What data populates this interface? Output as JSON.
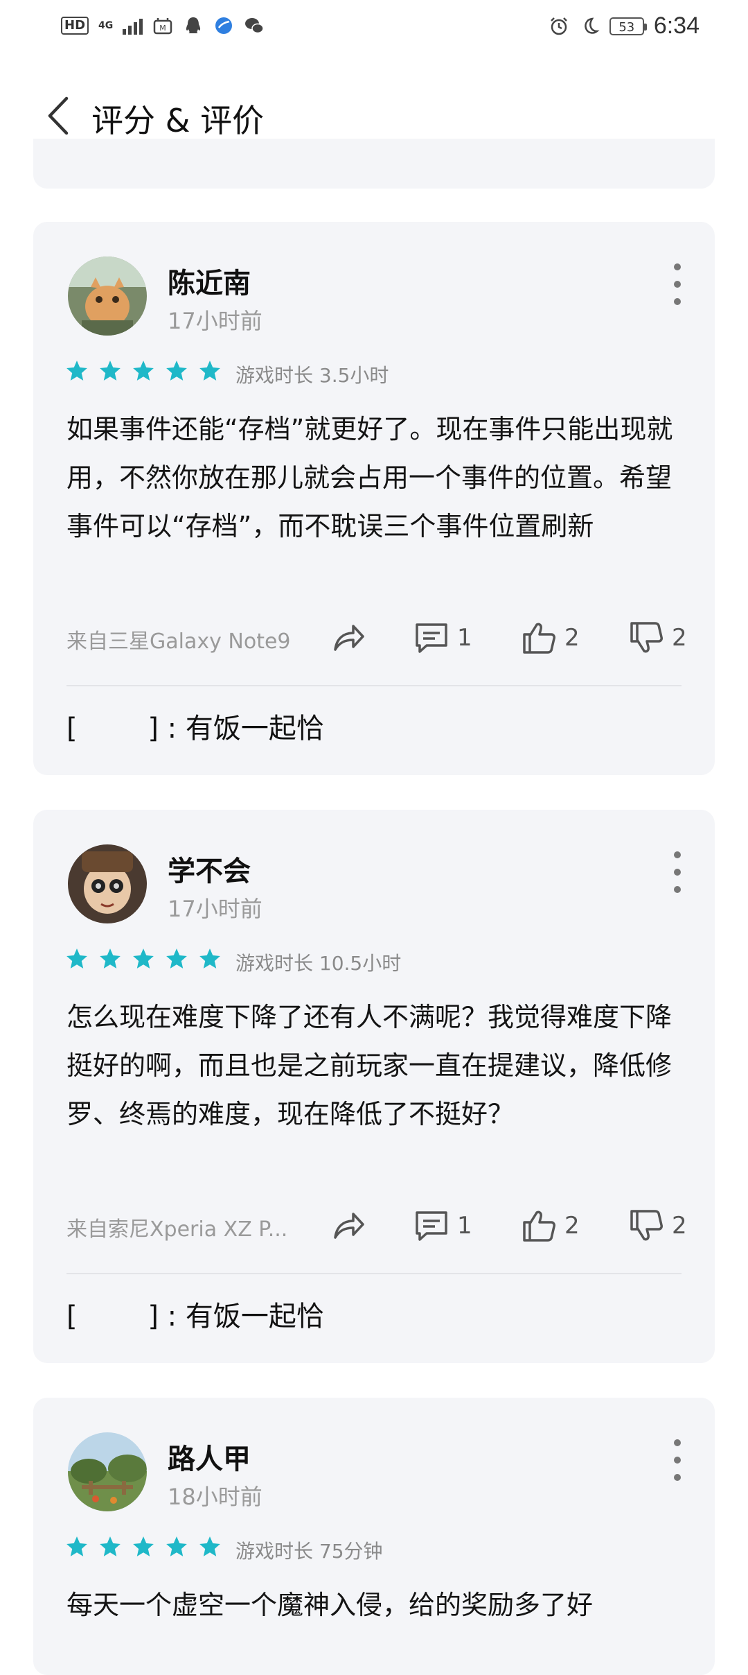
{
  "status_bar": {
    "left_badge": "HD",
    "network": "4G",
    "battery": "53",
    "time": "6:34",
    "icons": [
      "hd-icon",
      "signal-icon",
      "app-notification-icon",
      "qq-icon",
      "browser-icon",
      "wechat-icon",
      "alarm-icon",
      "moon-icon",
      "battery-icon"
    ]
  },
  "header": {
    "title": "评分 & 评价",
    "back_icon": "chevron-left-icon"
  },
  "reviews": [
    {
      "user": "陈近南",
      "time": "17小时前",
      "stars": 5,
      "playtime": "游戏时长 3.5小时",
      "text": "如果事件还能“存档”就更好了。现在事件只能出现就用，不然你放在那儿就会占用一个事件的位置。希望事件可以“存档”，而不耽误三个事件位置刷新",
      "device": "来自三星Galaxy Note9",
      "comments": "1",
      "likes": "2",
      "dislikes": "2",
      "reply": "[        ] : 有饭一起恰"
    },
    {
      "user": "学不会",
      "time": "17小时前",
      "stars": 5,
      "playtime": "游戏时长 10.5小时",
      "text": "怎么现在难度下降了还有人不满呢？我觉得难度下降挺好的啊，而且也是之前玩家一直在提建议，降低修罗、终焉的难度，现在降低了不挺好？",
      "device": "来自索尼Xperia XZ P...",
      "comments": "1",
      "likes": "2",
      "dislikes": "2",
      "reply": "[        ] : 有饭一起恰"
    },
    {
      "user": "路人甲",
      "time": "18小时前",
      "stars": 5,
      "playtime": "游戏时长 75分钟",
      "text": "每天一个虚空一个魔神入侵，给的奖励多了好"
    }
  ],
  "colors": {
    "star": "#1fb8c8",
    "card_bg": "#f4f5f8",
    "muted": "#9a9a9a"
  }
}
